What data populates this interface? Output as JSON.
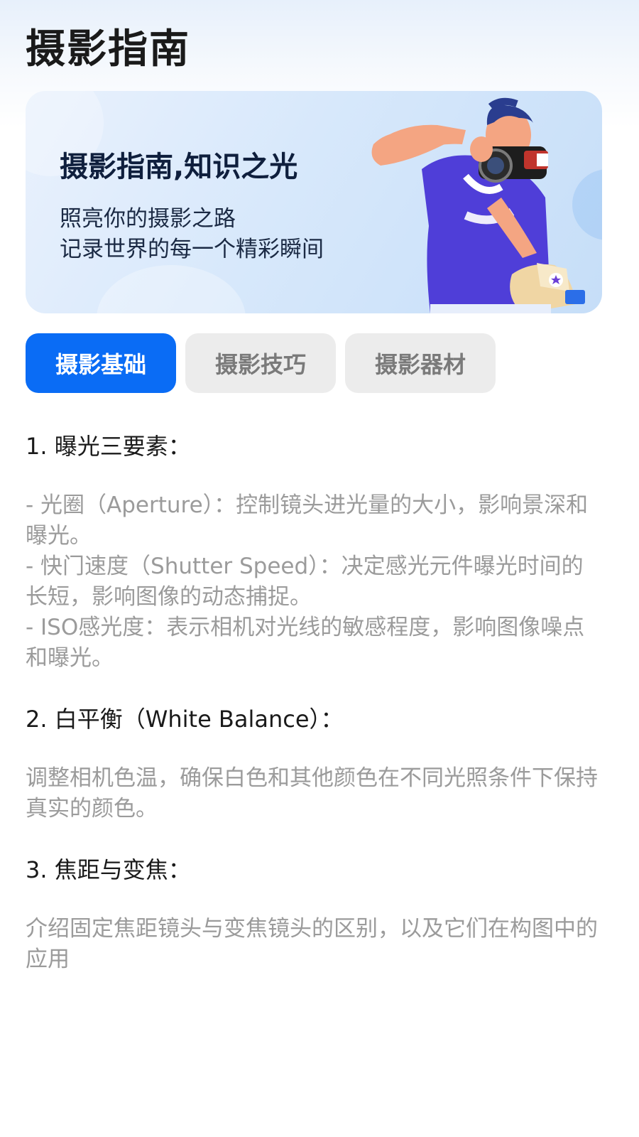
{
  "page": {
    "title": "摄影指南"
  },
  "banner": {
    "headline": "摄影指南,知识之光",
    "line1": "照亮你的摄影之路",
    "line2": "记录世界的每一个精彩瞬间",
    "illustration": "photographer-with-camera"
  },
  "tabs": [
    {
      "label": "摄影基础",
      "active": true
    },
    {
      "label": "摄影技巧",
      "active": false
    },
    {
      "label": "摄影器材",
      "active": false
    }
  ],
  "content": {
    "section1": {
      "heading": "1. 曝光三要素：",
      "items": [
        "  - 光圈（Aperture）：控制镜头进光量的大小，影响景深和曝光。",
        "  - 快门速度（Shutter Speed）：决定感光元件曝光时间的长短，影响图像的动态捕捉。",
        "  - ISO感光度：表示相机对光线的敏感程度，影响图像噪点和曝光。"
      ]
    },
    "section2": {
      "heading": "2. 白平衡（White Balance）：",
      "text": "调整相机色温，确保白色和其他颜色在不同光照条件下保持真实的颜色。"
    },
    "section3": {
      "heading": "3. 焦距与变焦：",
      "text": "介绍固定焦距镜头与变焦镜头的区别，以及它们在构图中的应用"
    }
  },
  "colors": {
    "accent": "#0a6cf5",
    "tab_inactive_bg": "#ececec",
    "tab_inactive_text": "#7a7a7a",
    "body_text": "#9b9b9b",
    "heading_text": "#1a1a1a"
  }
}
